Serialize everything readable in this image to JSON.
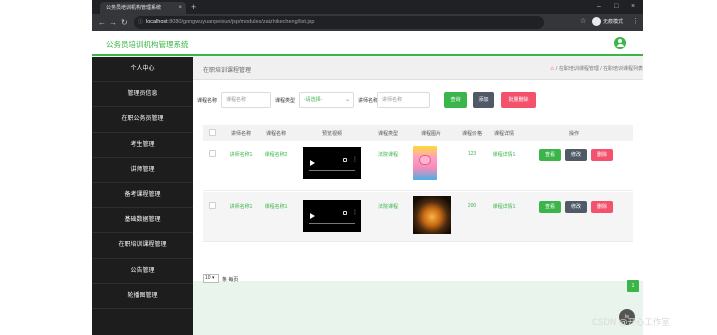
{
  "browser": {
    "tab_title": "公务员培训机构管理系统",
    "tab_close": "×",
    "new_tab": "+",
    "win_min": "–",
    "win_max": "□",
    "win_close": "×",
    "back": "←",
    "forward": "→",
    "reload": "↻",
    "url_host": "localhost",
    "url_rest": ":8080/gongwuyuanpeixun/jsp/modules/zaizhikecheng/list.jsp",
    "incognito_label": "无痕模式",
    "menu": "⋮"
  },
  "app": {
    "title": "公务员培训机构管理系统",
    "brand_color": "#3bb54a"
  },
  "sidebar": {
    "items": [
      {
        "label": "个人中心"
      },
      {
        "label": "管理员信息"
      },
      {
        "label": "在职公务员管理"
      },
      {
        "label": "考生管理"
      },
      {
        "label": "讲师管理"
      },
      {
        "label": "备考课程管理"
      },
      {
        "label": "基础数据管理"
      },
      {
        "label": "在职培训课程管理"
      },
      {
        "label": "公告管理"
      },
      {
        "label": "轮播图管理"
      }
    ]
  },
  "breadcrumb": {
    "page_title": "在职培训课程管理",
    "home_icon": "⌂",
    "trail": "/ 在职培训课程管理 / 在职培训课程列表"
  },
  "search": {
    "course_name_label": "课程名称",
    "course_name_placeholder": "课程名称",
    "course_type_label": "课程类型",
    "course_type_value": "-请选择-",
    "lecturer_label": "讲师名称",
    "lecturer_placeholder": "讲师名称",
    "query_button": "查询",
    "add_button": "添加",
    "batch_delete_button": "批量删除"
  },
  "table": {
    "columns": [
      "讲师名称",
      "课程名称",
      "预览视频",
      "课程类型",
      "课程图片",
      "课程价格",
      "课程详情",
      "操作"
    ],
    "rows": [
      {
        "lecturer": "讲师名称1",
        "course": "课程名称2",
        "type": "法院课程",
        "price": "123",
        "detail": "课程详情1",
        "image": "cartoon-pig-thumbnail"
      },
      {
        "lecturer": "讲师名称1",
        "course": "课程名称1",
        "type": "法院课程",
        "price": "200",
        "detail": "课程详情1",
        "image": "glowing-lamp-thumbnail"
      }
    ],
    "actions": {
      "view": "查看",
      "edit": "修改",
      "delete": "删除"
    }
  },
  "pager": {
    "page_size": "10",
    "per_page_text": "条 每页",
    "current_page": "1"
  },
  "overlay": {
    "float_label": "Ie",
    "watermark": "CSDN @开心工作室"
  }
}
